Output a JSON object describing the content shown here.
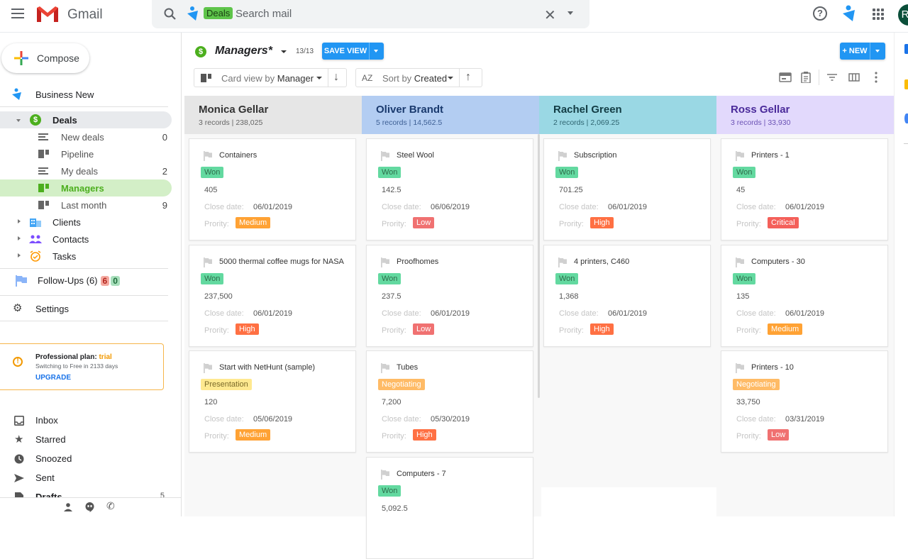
{
  "topbar": {
    "app_name": "Gmail",
    "search": {
      "chip": "Deals",
      "placeholder": "Search mail",
      "clear_icon": "close-icon",
      "options_icon": "chevron-down-icon"
    },
    "help_glyph": "?",
    "avatar_initial": "R"
  },
  "sidebar": {
    "compose_label": "Compose",
    "workspace": "Business New",
    "deals": {
      "label": "Deals",
      "items": [
        {
          "label": "New deals",
          "count": "0",
          "icon": "list-icon"
        },
        {
          "label": "Pipeline",
          "count": "",
          "icon": "board-icon"
        },
        {
          "label": "My deals",
          "count": "2",
          "icon": "list-icon"
        },
        {
          "label": "Managers",
          "count": "",
          "icon": "board-icon",
          "selected": true
        },
        {
          "label": "Last month",
          "count": "9",
          "icon": "board-icon"
        }
      ]
    },
    "folders": [
      {
        "label": "Clients",
        "icon": "building-icon"
      },
      {
        "label": "Contacts",
        "icon": "people-icon"
      },
      {
        "label": "Tasks",
        "icon": "alarm-clock-icon"
      }
    ],
    "followups": {
      "label": "Follow-Ups (6)",
      "overdue": "6",
      "upcoming": "0"
    },
    "settings_label": "Settings",
    "plan": {
      "title": "Professional plan: ",
      "status": "trial",
      "subtitle": "Switching to Free in 2133 days",
      "upgrade": "UPGRADE"
    },
    "mail": [
      {
        "label": "Inbox",
        "icon": "inbox-icon"
      },
      {
        "label": "Starred",
        "icon": "star-icon"
      },
      {
        "label": "Snoozed",
        "icon": "clock-icon"
      },
      {
        "label": "Sent",
        "icon": "send-icon"
      },
      {
        "label": "Drafts",
        "icon": "draft-icon",
        "count": "5"
      }
    ]
  },
  "view": {
    "title": "Managers*",
    "count": "13/13",
    "save_label": "SAVE VIEW",
    "new_label": "+ NEW",
    "card_view_prefix": "Card view by ",
    "card_view_value": "Manager",
    "sort_prefix": "Sort by ",
    "sort_value": "Created",
    "sort_icon_text": "AZ"
  },
  "card_labels": {
    "close_date": "Close date:",
    "priority": "Prority:"
  },
  "colors": {
    "won": "#63d9a0",
    "presentation": "#ffe990",
    "negotiating": "#ffbb66",
    "medium": "#ffa234",
    "low": "#f07171",
    "high": "#ff7043",
    "critical": "#f4605a"
  },
  "columns": [
    {
      "name": "Monica Gellar",
      "summary": "3 records | 238,025",
      "bg": "#e6e6e6",
      "fg": "#333333",
      "sub": "#666666",
      "cards": [
        {
          "title": "Containers",
          "stage": "Won",
          "amount": "405",
          "close_date": "06/01/2019",
          "priority": "Medium"
        },
        {
          "title": "5000 thermal coffee mugs for NASA",
          "stage": "Won",
          "amount": "237,500",
          "close_date": "06/01/2019",
          "priority": "High"
        },
        {
          "title": "Start with NetHunt (sample)",
          "stage": "Presentation",
          "amount": "120",
          "close_date": "05/06/2019",
          "priority": "Medium"
        }
      ]
    },
    {
      "name": "Oliver Brandt",
      "summary": "5 records | 14,562.5",
      "bg": "#b3cdf2",
      "fg": "#1a3a6e",
      "sub": "#3d5f94",
      "cards": [
        {
          "title": "Steel Wool",
          "stage": "Won",
          "amount": "142.5",
          "close_date": "06/06/2019",
          "priority": "Low"
        },
        {
          "title": "Proofhomes",
          "stage": "Won",
          "amount": "237.5",
          "close_date": "06/01/2019",
          "priority": "Low"
        },
        {
          "title": "Tubes",
          "stage": "Negotiating",
          "amount": "7,200",
          "close_date": "05/30/2019",
          "priority": "High"
        },
        {
          "title": "Computers - 7",
          "stage": "Won",
          "amount": "5,092.5",
          "close_date": "",
          "priority": ""
        }
      ]
    },
    {
      "name": "Rachel Green",
      "summary": "2 records | 2,069.25",
      "bg": "#9ad8e4",
      "fg": "#123c44",
      "sub": "#2e6470",
      "cards": [
        {
          "title": "Subscription",
          "stage": "Won",
          "amount": "701.25",
          "close_date": "06/01/2019",
          "priority": "High"
        },
        {
          "title": "4 printers, C460",
          "stage": "Won",
          "amount": "1,368",
          "close_date": "06/01/2019",
          "priority": "High"
        }
      ]
    },
    {
      "name": "Ross Gellar",
      "summary": "3 records | 33,930",
      "bg": "#e2d9fc",
      "fg": "#4a2a9a",
      "sub": "#6b52b5",
      "cards": [
        {
          "title": "Printers - 1",
          "stage": "Won",
          "amount": "45",
          "close_date": "06/01/2019",
          "priority": "Critical"
        },
        {
          "title": "Computers - 30",
          "stage": "Won",
          "amount": "135",
          "close_date": "06/01/2019",
          "priority": "Medium"
        },
        {
          "title": "Printers - 10",
          "stage": "Negotiating",
          "amount": "33,750",
          "close_date": "03/31/2019",
          "priority": "Low"
        }
      ]
    }
  ]
}
